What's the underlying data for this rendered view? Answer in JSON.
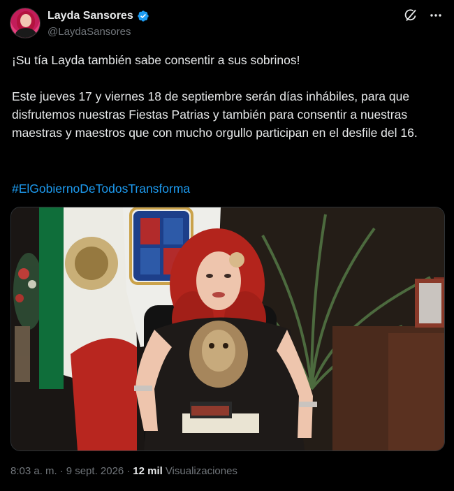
{
  "tweet": {
    "author": {
      "display_name": "Layda Sansores",
      "handle": "@LaydaSansores",
      "verified": true
    },
    "icons": [
      "verified-badge-icon",
      "grok-icon",
      "more-icon"
    ],
    "paragraphs": [
      "¡Su tía Layda también sabe consentir a sus sobrinos!",
      "Este jueves 17 y viernes 18 de septiembre serán días inhábiles, para que disfrutemos nuestras Fiestas Patrias y también para consentir a nuestras maestras y maestros que con mucho orgullo participan en el desfile del 16."
    ],
    "hashtag": "#ElGobiernoDeTodosTransforma",
    "meta": {
      "time": "8:03 a. m.",
      "separator": "·",
      "date": "9 sept. 2026",
      "views_count": "12 mil",
      "views_label": "Visualizaciones"
    },
    "colors": {
      "background": "#000000",
      "text": "#e7e9ea",
      "muted": "#71767b",
      "link": "#1d9bf0"
    }
  }
}
